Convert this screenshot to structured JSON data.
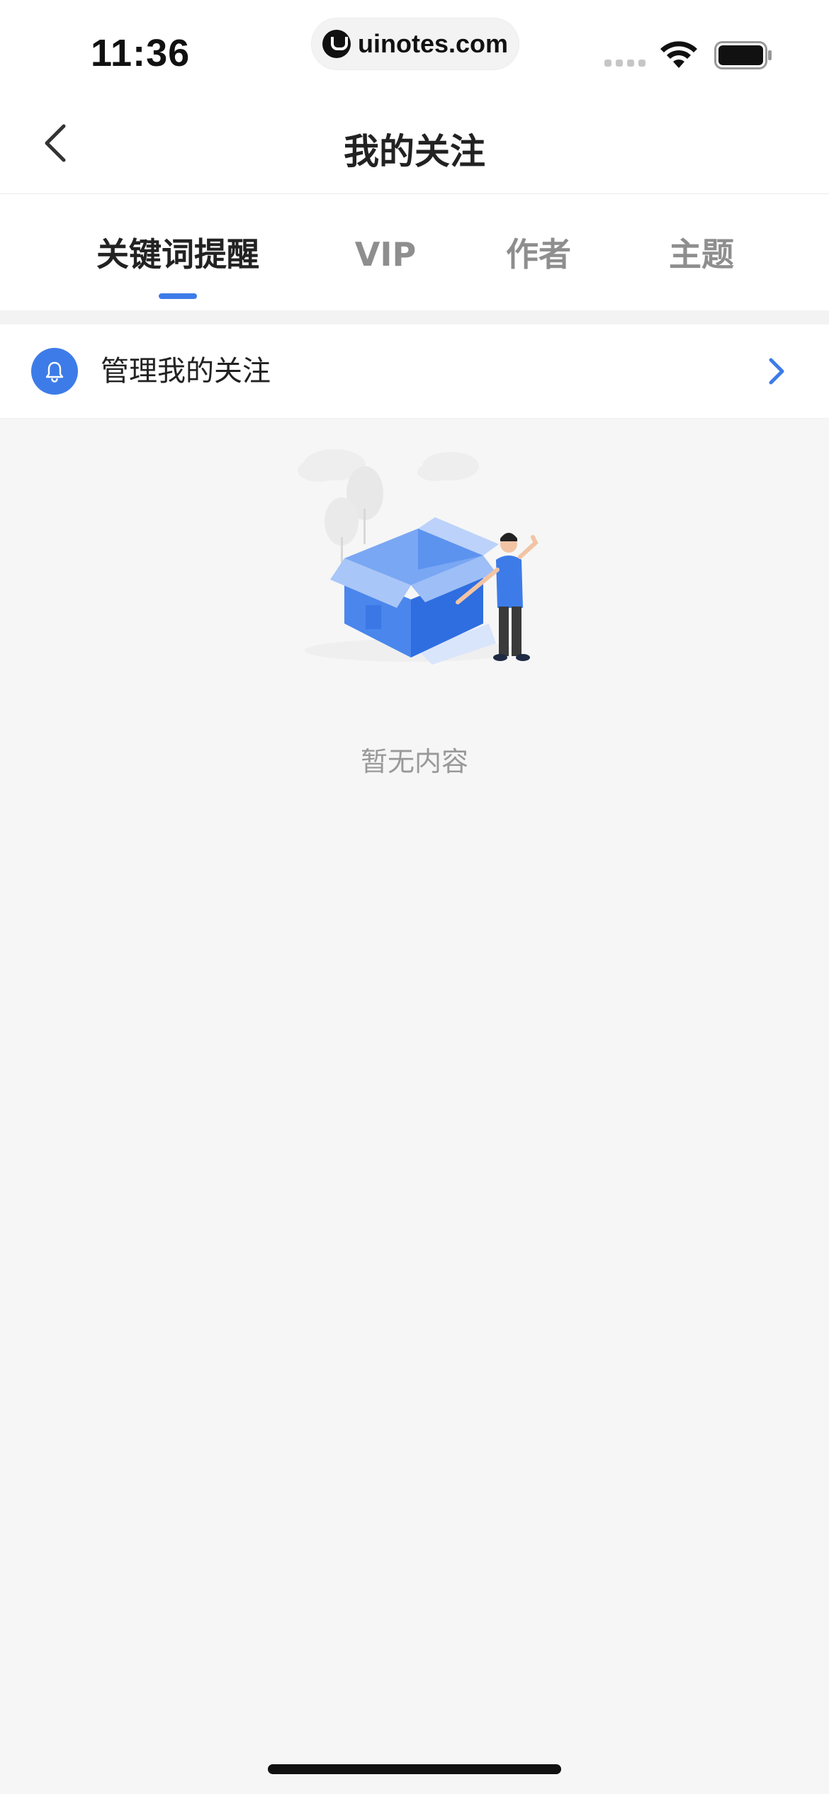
{
  "status_bar": {
    "time": "11:36",
    "url": "uinotes.com"
  },
  "nav": {
    "title": "我的关注"
  },
  "tabs": [
    {
      "label": "关键词提醒",
      "active": true
    },
    {
      "label": "VIP",
      "active": false
    },
    {
      "label": "作者",
      "active": false
    },
    {
      "label": "主题",
      "active": false
    }
  ],
  "manage_row": {
    "label": "管理我的关注",
    "icon": "bell-icon"
  },
  "empty_state": {
    "text": "暂无内容"
  },
  "colors": {
    "accent": "#3d7ce8",
    "background": "#f6f6f6",
    "muted_text": "#999999"
  }
}
